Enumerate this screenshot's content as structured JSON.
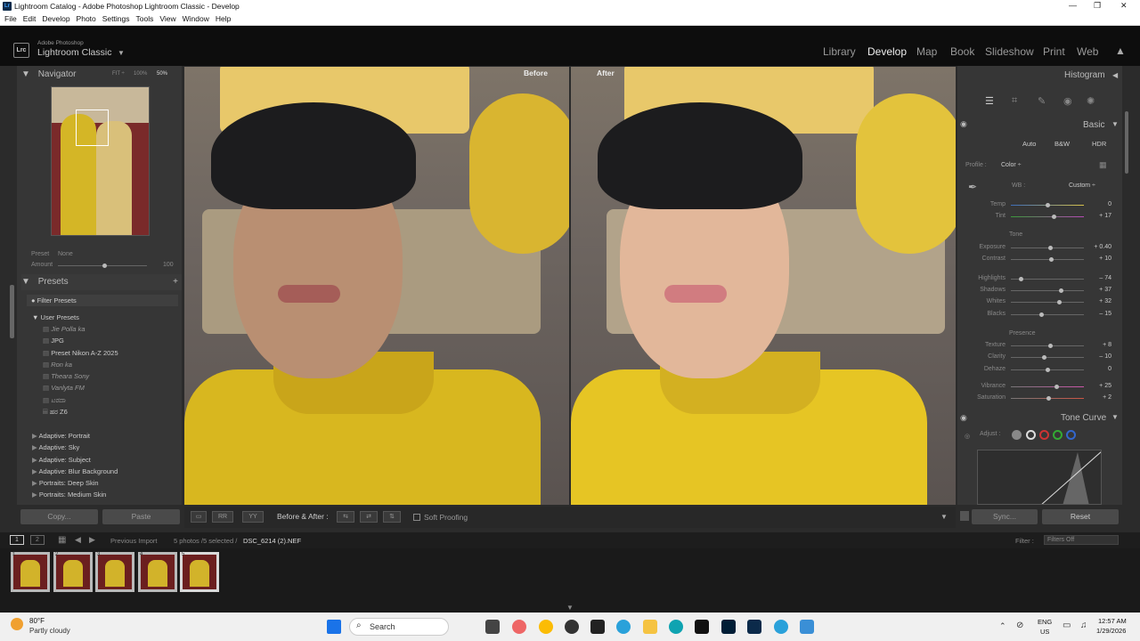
{
  "window": {
    "title": "Lightroom Catalog - Adobe Photoshop Lightroom Classic - Develop",
    "logo": "Lr",
    "controls": [
      "—",
      "❐",
      "✕"
    ]
  },
  "menu": [
    "File",
    "Edit",
    "Develop",
    "Photo",
    "Settings",
    "Tools",
    "View",
    "Window",
    "Help"
  ],
  "brand": {
    "badge": "Lrc",
    "line1": "Adobe Photoshop",
    "line2": "Lightroom Classic"
  },
  "modules": [
    "Library",
    "Develop",
    "Map",
    "Book",
    "Slideshow",
    "Print",
    "Web"
  ],
  "active_module": "Develop",
  "navigator": {
    "title": "Navigator",
    "fit": "FIT ÷",
    "p100": "100%",
    "zoom": "50%"
  },
  "preset_row": {
    "preset_label": "Preset",
    "preset_value": "None",
    "amount_label": "Amount",
    "amount_value": "100"
  },
  "presets": {
    "title": "Presets",
    "filter": "Filter Presets",
    "group": "User Presets",
    "user_items": [
      "Jie Polla ka",
      "JPG",
      "Preset Nikon A-Z 2025",
      "Ron ka",
      "Theara Sony",
      "Vanlyta FM",
      "ಟರದಾ",
      "ಹರ Z6"
    ],
    "adaptive": [
      "Adaptive: Portrait",
      "Adaptive: Sky",
      "Adaptive: Subject",
      "Adaptive: Blur Background",
      "Portraits: Deep Skin",
      "Portraits: Medium Skin"
    ]
  },
  "left_buttons": {
    "copy": "Copy...",
    "paste": "Paste"
  },
  "view_labels": {
    "before": "Before",
    "after": "After"
  },
  "toolbar": {
    "mode": "Before & After :",
    "softproof": "Soft Proofing"
  },
  "right_panel": {
    "histogram": "Histogram",
    "basic": "Basic",
    "treatment": [
      "Auto",
      "B&W",
      "HDR"
    ],
    "profile_label": "Profile :",
    "profile_value": "Color ÷",
    "wb_label": "WB :",
    "wb_value": "Custom ÷",
    "tone_label": "Tone",
    "presence_label": "Presence",
    "sliders": [
      {
        "label": "Temp",
        "value": "0",
        "pos": 0.5
      },
      {
        "label": "Tint",
        "value": "+ 17",
        "pos": 0.58
      },
      {
        "label": "Exposure",
        "value": "+ 0.40",
        "pos": 0.54
      },
      {
        "label": "Contrast",
        "value": "+ 10",
        "pos": 0.55
      },
      {
        "label": "Highlights",
        "value": "– 74",
        "pos": 0.13
      },
      {
        "label": "Shadows",
        "value": "+ 37",
        "pos": 0.68
      },
      {
        "label": "Whites",
        "value": "+ 32",
        "pos": 0.66
      },
      {
        "label": "Blacks",
        "value": "– 15",
        "pos": 0.42
      },
      {
        "label": "Texture",
        "value": "+ 8",
        "pos": 0.54
      },
      {
        "label": "Clarity",
        "value": "– 10",
        "pos": 0.45
      },
      {
        "label": "Dehaze",
        "value": "0",
        "pos": 0.5
      },
      {
        "label": "Vibrance",
        "value": "+ 25",
        "pos": 0.62
      },
      {
        "label": "Saturation",
        "value": "+ 2",
        "pos": 0.51
      }
    ],
    "tone_curve": "Tone Curve",
    "adjust": "Adjust :",
    "sync": "Sync...",
    "reset": "Reset"
  },
  "filmstrip": {
    "prev": "Previous Import",
    "count": "5 photos /5 selected /",
    "file": "DSC_6214 (2).NEF",
    "filter_label": "Filter :",
    "filter_value": "Filters Off",
    "pages": [
      "1",
      "2"
    ],
    "thumb_nums": [
      "1",
      "2",
      "3",
      "4",
      "5"
    ]
  },
  "taskbar": {
    "temp": "80°F",
    "weather": "Partly cloudy",
    "search": "Search",
    "lang1": "ENG",
    "lang2": "US",
    "time": "12:57 AM",
    "date": "1/29/2026"
  }
}
